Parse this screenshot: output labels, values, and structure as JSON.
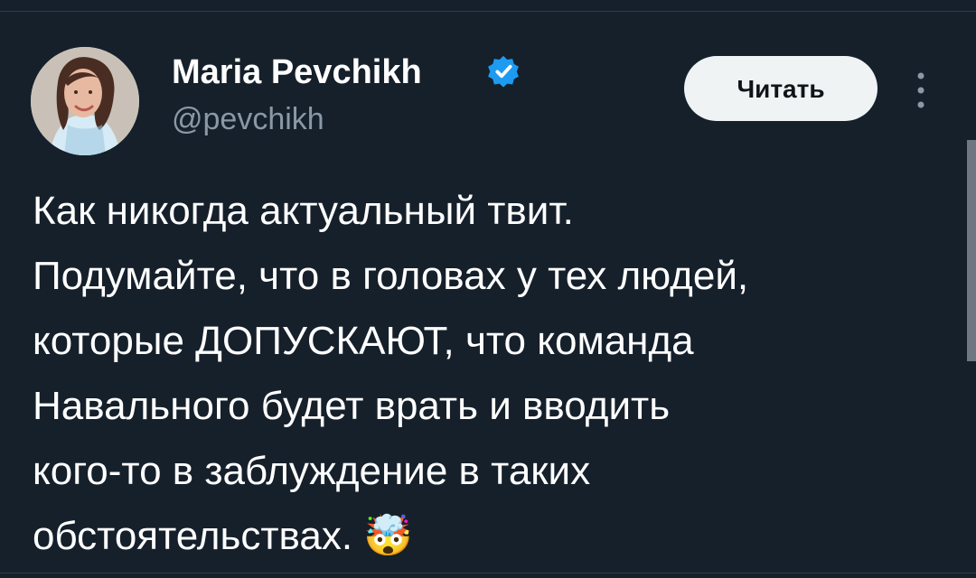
{
  "author": {
    "name": "Maria Pevchikh",
    "handle": "@pevchikh",
    "verified": true,
    "avatar_icon": "avatar-photo"
  },
  "actions": {
    "follow_label": "Читать",
    "more_icon": "more-vertical-icon"
  },
  "tweet": {
    "text": "Как никогда актуальный твит.\nПодумайте, что в головах у тех людей,\nкоторые ДОПУСКАЮТ, что команда\nНавального будет врать и вводить\nкого-то в заблуждение в таких\nобстоятельствах. 🤯"
  },
  "colors": {
    "background": "#15202b",
    "text": "#ffffff",
    "secondary_text": "#8b98a5",
    "verified": "#1d9bf0",
    "button_bg": "#eff3f4",
    "button_text": "#0f1419"
  }
}
